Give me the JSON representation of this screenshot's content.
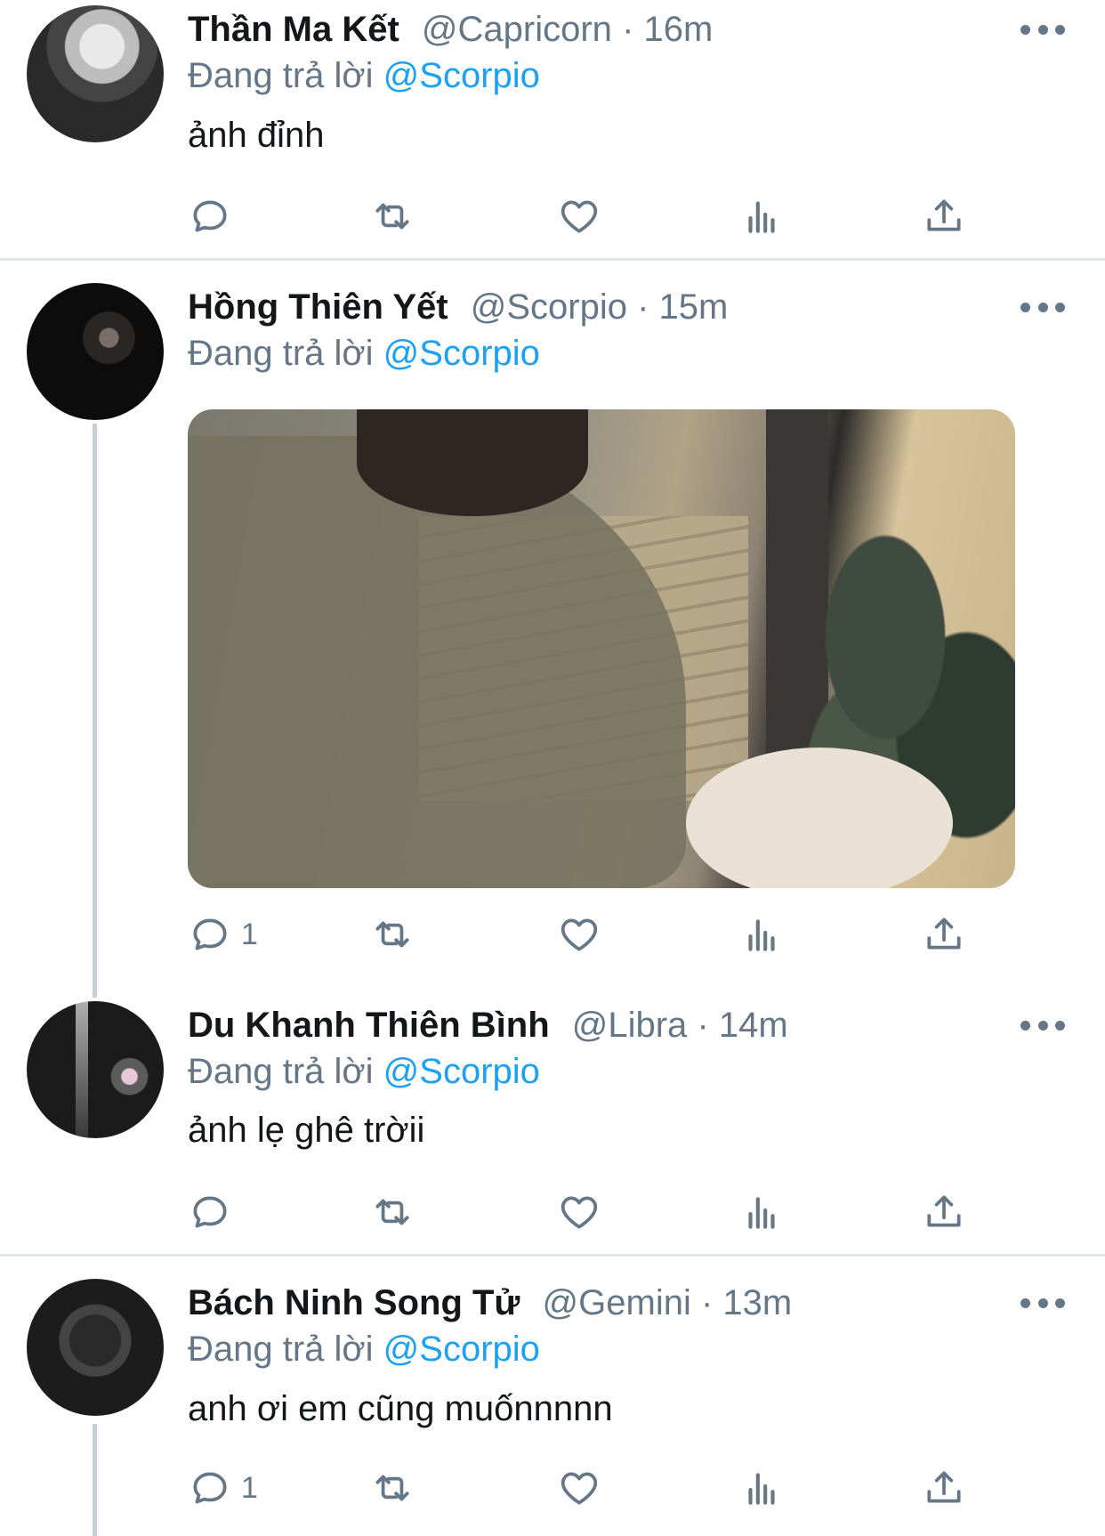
{
  "colors": {
    "text": "#14171a",
    "secondary": "#657786",
    "link": "#1da1f2",
    "divider": "#e1e8ed",
    "thread": "#c4cfd6"
  },
  "icons": {
    "reply": "reply-icon",
    "retweet": "retweet-icon",
    "like": "heart-icon",
    "analytics": "analytics-icon",
    "share": "share-icon",
    "more": "more-icon"
  },
  "tweets": [
    {
      "name": "Thần Ma Kết",
      "handle": "@Capricorn",
      "separator": "·",
      "time": "16m",
      "reply_prefix": "Đang trả lời",
      "reply_to": "@Scorpio",
      "text": "ảnh đỉnh",
      "reply_count": ""
    },
    {
      "name": "Hồng Thiên Yết",
      "handle": "@Scorpio",
      "separator": "·",
      "time": "15m",
      "reply_prefix": "Đang trả lời",
      "reply_to": "@Scorpio",
      "text": "",
      "reply_count": "1"
    },
    {
      "name": "Du Khanh Thiên Bình",
      "handle": "@Libra",
      "separator": "·",
      "time": "14m",
      "reply_prefix": "Đang trả lời",
      "reply_to": "@Scorpio",
      "text": "ảnh lẹ ghê trờii",
      "reply_count": ""
    },
    {
      "name": "Bách Ninh Song Tử",
      "handle": "@Gemini",
      "separator": "·",
      "time": "13m",
      "reply_prefix": "Đang trả lời",
      "reply_to": "@Scorpio",
      "text": "anh ơi em cũng muốnnnnn",
      "reply_count": "1"
    }
  ]
}
